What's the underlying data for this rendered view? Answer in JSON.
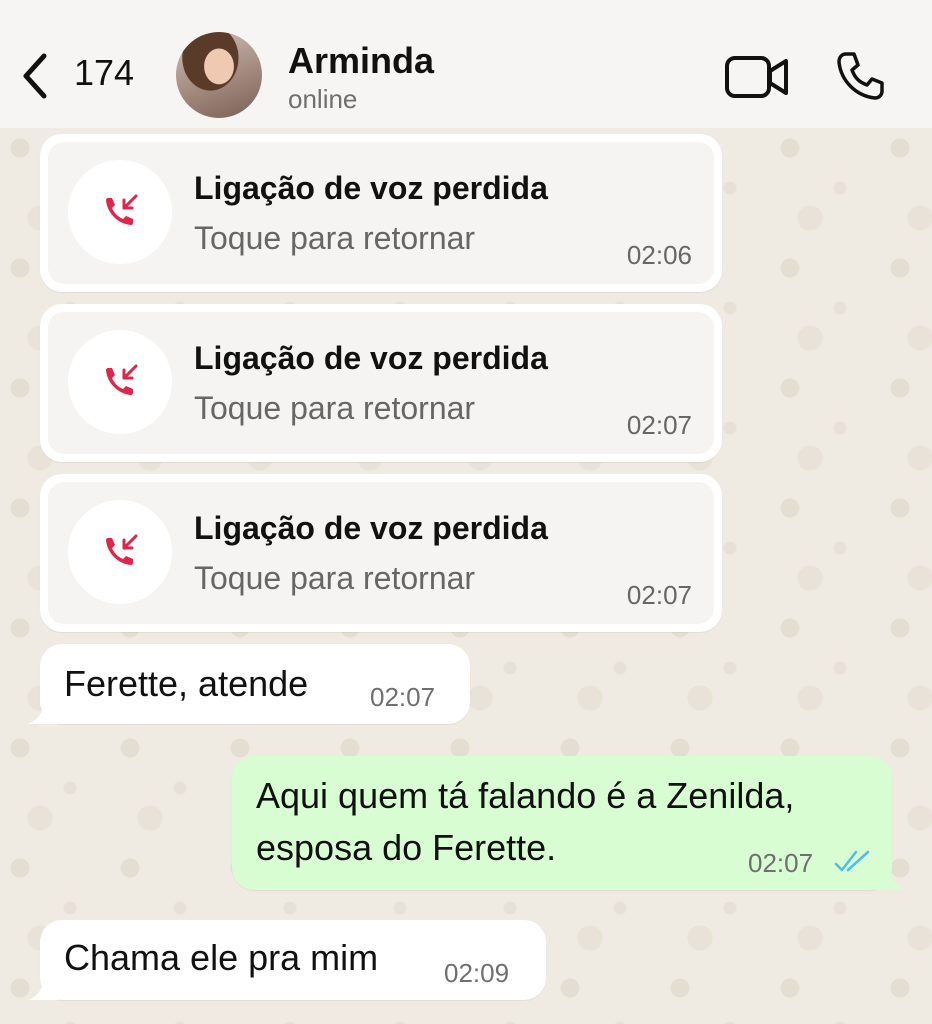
{
  "header": {
    "back_count": "174",
    "contact_name": "Arminda",
    "contact_status": "online"
  },
  "colors": {
    "missed_call_red": "#e0244a",
    "outgoing_bubble": "#d9fdd3",
    "incoming_bubble": "#ffffff",
    "read_ticks_blue": "#53bdeb"
  },
  "messages": [
    {
      "type": "missed_call",
      "title": "Ligação de voz perdida",
      "subtitle": "Toque para retornar",
      "time": "02:06"
    },
    {
      "type": "missed_call",
      "title": "Ligação de voz perdida",
      "subtitle": "Toque para retornar",
      "time": "02:07"
    },
    {
      "type": "missed_call",
      "title": "Ligação de voz perdida",
      "subtitle": "Toque para retornar",
      "time": "02:07"
    },
    {
      "type": "incoming",
      "text": "Ferette, atende",
      "time": "02:07"
    },
    {
      "type": "outgoing",
      "line1": "Aqui quem tá falando é a Zenilda,",
      "line2": "esposa do Ferette.",
      "time": "02:07",
      "status_icon": "double-check-read-icon"
    },
    {
      "type": "incoming",
      "text": "Chama ele pra mim",
      "time": "02:09"
    }
  ]
}
